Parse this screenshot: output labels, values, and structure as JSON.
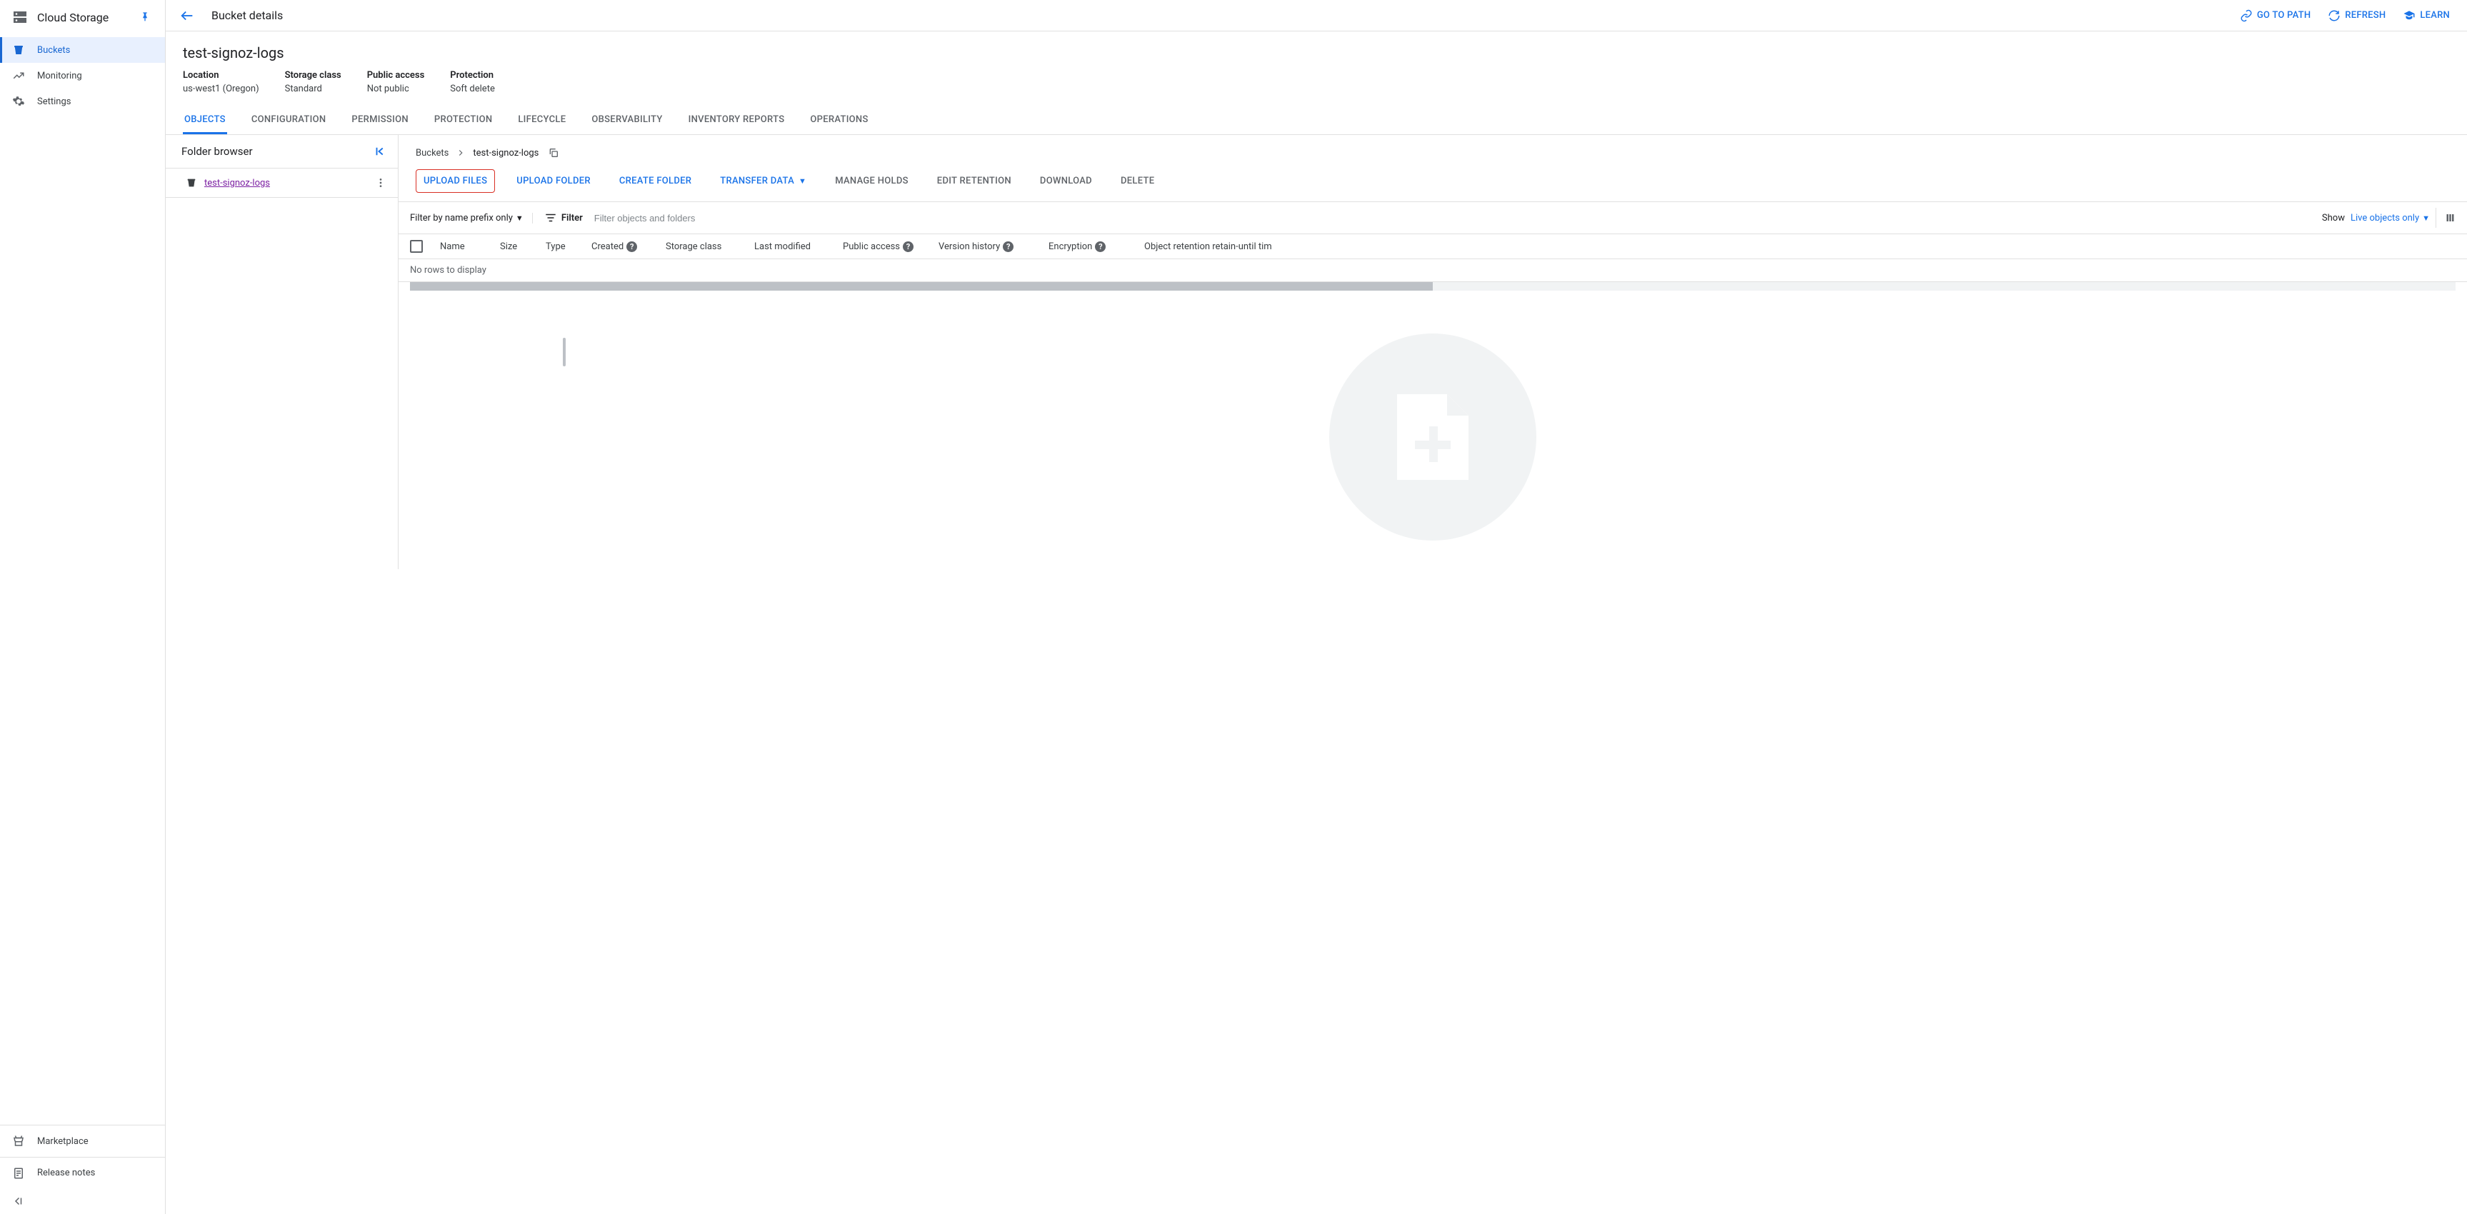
{
  "product": {
    "title": "Cloud Storage"
  },
  "sidebar": {
    "items": [
      {
        "label": "Buckets"
      },
      {
        "label": "Monitoring"
      },
      {
        "label": "Settings"
      }
    ],
    "footer": [
      {
        "label": "Marketplace"
      },
      {
        "label": "Release notes"
      }
    ]
  },
  "topbar": {
    "title": "Bucket details",
    "actions": {
      "go_to_path": "GO TO PATH",
      "refresh": "REFRESH",
      "learn": "LEARN"
    }
  },
  "bucket": {
    "name": "test-signoz-logs",
    "meta": {
      "location_label": "Location",
      "location_value": "us-west1 (Oregon)",
      "storage_class_label": "Storage class",
      "storage_class_value": "Standard",
      "public_access_label": "Public access",
      "public_access_value": "Not public",
      "protection_label": "Protection",
      "protection_value": "Soft delete"
    }
  },
  "tabs": [
    "OBJECTS",
    "CONFIGURATION",
    "PERMISSION",
    "PROTECTION",
    "LIFECYCLE",
    "OBSERVABILITY",
    "INVENTORY REPORTS",
    "OPERATIONS"
  ],
  "folder_panel": {
    "title": "Folder browser",
    "bucket_link": "test-signoz-logs"
  },
  "breadcrumb": {
    "root": "Buckets",
    "current": "test-signoz-logs"
  },
  "actions": {
    "upload_files": "UPLOAD FILES",
    "upload_folder": "UPLOAD FOLDER",
    "create_folder": "CREATE FOLDER",
    "transfer_data": "TRANSFER DATA",
    "manage_holds": "MANAGE HOLDS",
    "edit_retention": "EDIT RETENTION",
    "download": "DOWNLOAD",
    "delete": "DELETE"
  },
  "filter": {
    "mode": "Filter by name prefix only",
    "label": "Filter",
    "placeholder": "Filter objects and folders",
    "show_label": "Show",
    "show_value": "Live objects only"
  },
  "columns": {
    "name": "Name",
    "size": "Size",
    "type": "Type",
    "created": "Created",
    "storage_class": "Storage class",
    "last_modified": "Last modified",
    "public_access": "Public access",
    "version_history": "Version history",
    "encryption": "Encryption",
    "retention": "Object retention retain-until tim"
  },
  "table": {
    "empty": "No rows to display"
  }
}
